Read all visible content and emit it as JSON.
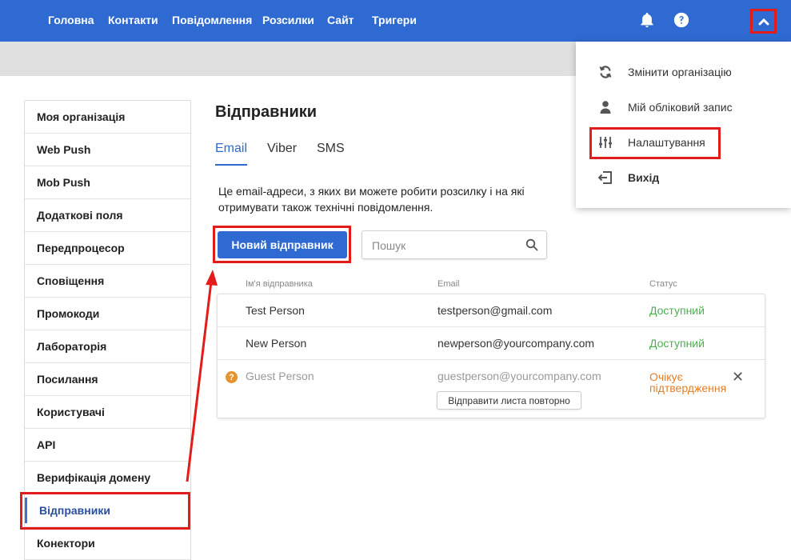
{
  "topnav": {
    "items": [
      "Головна",
      "Контакти",
      "Повідомлення",
      "Розсилки",
      "Сайт",
      "Тригери"
    ],
    "accent_color": "#2e6ad1"
  },
  "sidebar": {
    "items": [
      "Моя організація",
      "Web Push",
      "Mob Push",
      "Додаткові поля",
      "Передпроцесор",
      "Сповіщення",
      "Промокоди",
      "Лабораторія",
      "Посилання",
      "Користувачі",
      "API",
      "Верифікація домену",
      "Відправники",
      "Конектори"
    ],
    "active": "Відправники"
  },
  "main": {
    "title": "Відправники",
    "tabs": [
      "Email",
      "Viber",
      "SMS"
    ],
    "active_tab": "Email",
    "description": "Це email-адреси, з яких ви можете робити розсилку і на які отримувати також технічні повідомлення.",
    "new_button": "Новий відправник",
    "search_placeholder": "Пошук"
  },
  "table": {
    "headers": [
      "Ім'я відправника",
      "Email",
      "Статус"
    ],
    "rows": [
      {
        "name": "Test Person",
        "email": "testperson@gmail.com",
        "status": "Доступний",
        "state": "available"
      },
      {
        "name": "New Person",
        "email": "newperson@yourcompany.com",
        "status": "Доступний",
        "state": "available"
      },
      {
        "name": "Guest Person",
        "email": "guestperson@yourcompany.com",
        "status_line1": "Очікує",
        "status_line2": "підтвердження",
        "state": "pending",
        "resend_label": "Відправити листа повторно"
      }
    ]
  },
  "dropdown": {
    "items": [
      {
        "label": "Змінити організацію",
        "icon": "refresh-icon"
      },
      {
        "label": "Мій обліковий запис",
        "icon": "user-icon"
      },
      {
        "label": "Налаштування",
        "icon": "sliders-icon"
      },
      {
        "label": "Вихід",
        "icon": "logout-icon"
      }
    ]
  },
  "colors": {
    "available": "#4caf50",
    "pending": "#e07f2a",
    "highlight": "#e21b1b"
  }
}
